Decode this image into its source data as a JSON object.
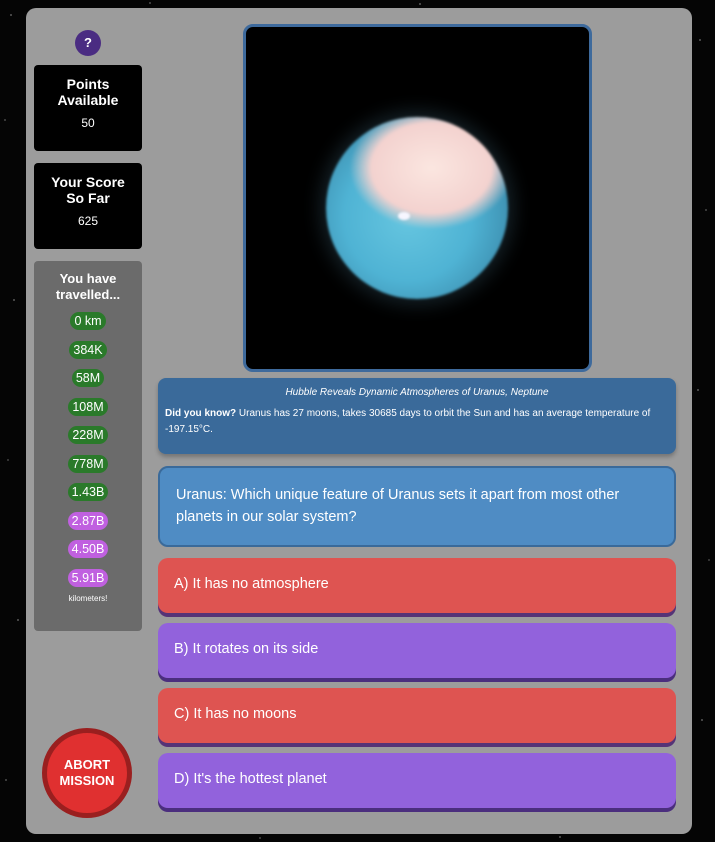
{
  "sidebar": {
    "help_label": "?",
    "points": {
      "title_line1": "Points",
      "title_line2": "Available",
      "value": "50"
    },
    "score": {
      "title_line1": "Your Score",
      "title_line2": "So Far",
      "value": "625"
    },
    "travel": {
      "title_line1": "You have",
      "title_line2": "travelled...",
      "distances": [
        {
          "label": "0 km",
          "status": "reached"
        },
        {
          "label": "384K",
          "status": "reached"
        },
        {
          "label": "58M",
          "status": "reached"
        },
        {
          "label": "108M",
          "status": "reached"
        },
        {
          "label": "228M",
          "status": "reached"
        },
        {
          "label": "778M",
          "status": "reached"
        },
        {
          "label": "1.43B",
          "status": "reached"
        },
        {
          "label": "2.87B",
          "status": "pending"
        },
        {
          "label": "4.50B",
          "status": "pending"
        },
        {
          "label": "5.91B",
          "status": "pending"
        }
      ],
      "footer": "kilometers!"
    },
    "abort_line1": "ABORT",
    "abort_line2": "MISSION"
  },
  "image": {
    "icon": "uranus-planet-image"
  },
  "caption": {
    "title": "Hubble Reveals Dynamic Atmospheres of Uranus, Neptune",
    "fact_prefix": "Did you know?",
    "fact_text": " Uranus has 27 moons, takes 30685 days to orbit the Sun and has an average temperature of -197.15°C."
  },
  "question": {
    "text": "Uranus: Which unique feature of Uranus sets it apart from most other planets in our solar system?"
  },
  "answers": [
    {
      "label": "A) It has no atmosphere",
      "color": "#de5451"
    },
    {
      "label": "B) It rotates on its side",
      "color": "#9262dc"
    },
    {
      "label": "C) It has no moons",
      "color": "#de5451"
    },
    {
      "label": "D) It's the hottest planet",
      "color": "#9262dc"
    }
  ],
  "colors": {
    "panel": "#9c9c9c",
    "reached": "#2a7a2a",
    "pending": "#c060e0",
    "abort": "#e03030",
    "question": "#4f8cc4",
    "caption": "#3a6a9a"
  }
}
